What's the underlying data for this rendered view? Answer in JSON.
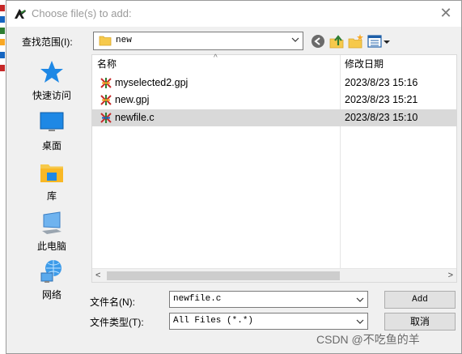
{
  "dialog": {
    "title": "Choose file(s) to add:",
    "close_glyph": "✕"
  },
  "lookin": {
    "label": "查找范围(I):",
    "value": "new"
  },
  "places": [
    {
      "label": "快速访问",
      "icon": "star-icon"
    },
    {
      "label": "桌面",
      "icon": "desktop-icon"
    },
    {
      "label": "库",
      "icon": "library-icon"
    },
    {
      "label": "此电脑",
      "icon": "computer-icon"
    },
    {
      "label": "网络",
      "icon": "network-icon"
    }
  ],
  "filelist": {
    "columns": {
      "name": "名称",
      "date": "修改日期"
    },
    "rows": [
      {
        "name": "myselected2.gpj",
        "date": "2023/8/23 15:16",
        "selected": false
      },
      {
        "name": "new.gpj",
        "date": "2023/8/23 15:21",
        "selected": false
      },
      {
        "name": "newfile.c",
        "date": "2023/8/23 15:10",
        "selected": true
      }
    ]
  },
  "filename": {
    "label": "文件名(N):",
    "value": "newfile.c"
  },
  "filetype": {
    "label": "文件类型(T):",
    "value": "All Files (*.*)"
  },
  "buttons": {
    "add": "Add",
    "cancel": "取消"
  },
  "watermark": "CSDN @不吃鱼的羊",
  "colors": {
    "accent": "#1e88e5",
    "selected_row": "#d9d9d9",
    "folder": "#f6c94b"
  }
}
